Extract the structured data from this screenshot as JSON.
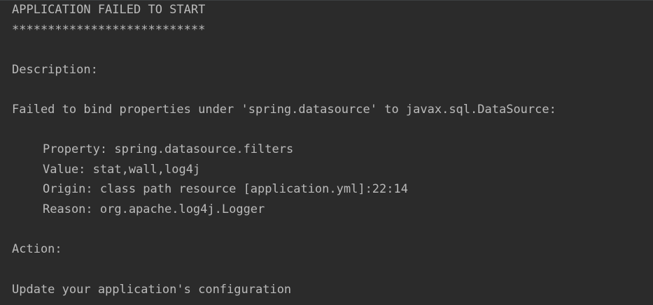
{
  "console": {
    "title": "APPLICATION FAILED TO START",
    "separator": "***************************",
    "description_label": "Description:",
    "failure_message": "Failed to bind properties under 'spring.datasource' to javax.sql.DataSource:",
    "details": {
      "property": "Property: spring.datasource.filters",
      "value": "Value: stat,wall,log4j",
      "origin": "Origin: class path resource [application.yml]:22:14",
      "reason": "Reason: org.apache.log4j.Logger"
    },
    "action_label": "Action:",
    "action_message": "Update your application's configuration"
  }
}
